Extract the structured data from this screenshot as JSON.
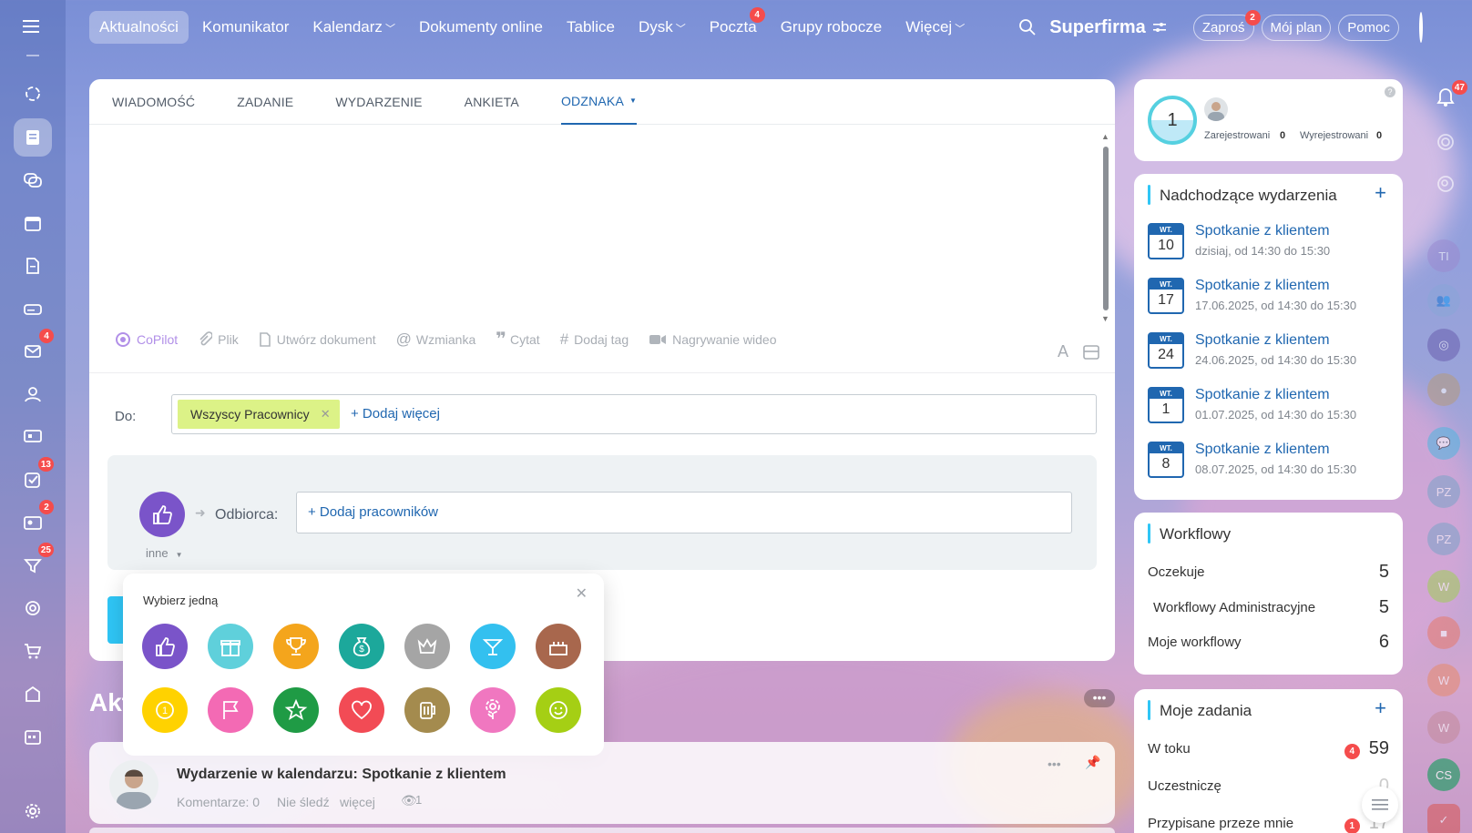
{
  "nav": {
    "items": [
      {
        "label": "Aktualności",
        "active": true
      },
      {
        "label": "Komunikator"
      },
      {
        "label": "Kalendarz",
        "dropdown": true
      },
      {
        "label": "Dokumenty online"
      },
      {
        "label": "Tablice"
      },
      {
        "label": "Dysk",
        "dropdown": true
      },
      {
        "label": "Poczta",
        "badge": "4"
      },
      {
        "label": "Grupy robocze"
      },
      {
        "label": "Więcej",
        "dropdown": true
      }
    ],
    "brand": "Superfirma",
    "invite": "Zaproś",
    "invite_badge": "2",
    "my_plan": "Mój plan",
    "help": "Pomoc"
  },
  "rail": {
    "badges": {
      "mail": "4",
      "tasks": "13",
      "feed": "2",
      "funnel": "25"
    }
  },
  "composer": {
    "tabs": [
      "WIADOMOŚĆ",
      "ZADANIE",
      "WYDARZENIE",
      "ANKIETA",
      "ODZNAKA"
    ],
    "tools": [
      "CoPilot",
      "Plik",
      "Utwórz dokument",
      "Wzmianka",
      "Cytat",
      "Dodaj tag",
      "Nagrywanie wideo"
    ],
    "to_label": "Do:",
    "recipient_tag": "Wszyscy Pracownicy",
    "add_more": "+ Dodaj więcej",
    "badge_recipient_label": "Odbiorca:",
    "add_employees": "+ Dodaj pracowników",
    "badge_type": "inne"
  },
  "popup": {
    "title": "Wybierz jedną",
    "badges": [
      "thumbs-up",
      "gift",
      "trophy",
      "money-bag",
      "crown",
      "cocktail",
      "cake",
      "coin",
      "flag",
      "star",
      "heart",
      "beer",
      "flower",
      "smiley"
    ]
  },
  "feed": {
    "title_fragment": "Akt",
    "post": {
      "title": "Wydarzenie w kalendarzu: Spotkanie z klientem",
      "comments": "Komentarze: 0",
      "unfollow": "Nie śledź",
      "more": "więcej",
      "views": "1"
    }
  },
  "stats": {
    "count": "1",
    "registered_label": "Zarejestrowani",
    "registered": "0",
    "unregistered_label": "Wyrejestrowani",
    "unregistered": "0"
  },
  "events": {
    "title": "Nadchodzące wydarzenia",
    "items": [
      {
        "dow": "WT.",
        "day": "10",
        "title": "Spotkanie z klientem",
        "when": "dzisiaj, od 14:30 do 15:30"
      },
      {
        "dow": "WT.",
        "day": "17",
        "title": "Spotkanie z klientem",
        "when": "17.06.2025, od 14:30 do 15:30"
      },
      {
        "dow": "WT.",
        "day": "24",
        "title": "Spotkanie z klientem",
        "when": "24.06.2025, od 14:30 do 15:30"
      },
      {
        "dow": "WT.",
        "day": "1",
        "title": "Spotkanie z klientem",
        "when": "01.07.2025, od 14:30 do 15:30"
      },
      {
        "dow": "WT.",
        "day": "8",
        "title": "Spotkanie z klientem",
        "when": "08.07.2025, od 14:30 do 15:30"
      }
    ]
  },
  "workflows": {
    "title": "Workflowy",
    "rows": [
      {
        "label": "Oczekuje",
        "value": "5"
      },
      {
        "label": "Workflowy Administracyjne",
        "value": "5"
      },
      {
        "label": "Moje workflowy",
        "value": "6"
      }
    ]
  },
  "tasks": {
    "title": "Moje zadania",
    "rows": [
      {
        "label": "W toku",
        "value": "59",
        "badge": "4"
      },
      {
        "label": "Uczestniczę",
        "value": "0"
      },
      {
        "label": "Przypisane przeze mnie",
        "value": "17",
        "badge": "1"
      }
    ]
  },
  "right_rail": {
    "notif_badge": "47",
    "avatars": [
      "TI",
      "PZ",
      "PZ",
      "W",
      "W",
      "W",
      "CS"
    ]
  },
  "colors": {
    "accent": "#2067b0",
    "badge_red": "#f54c4c",
    "tag_bg": "#dcf287"
  }
}
